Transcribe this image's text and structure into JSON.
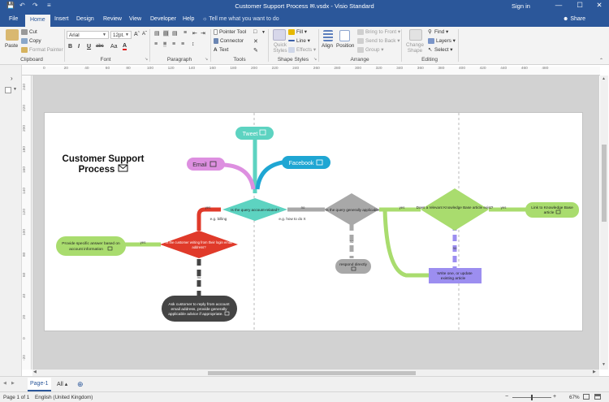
{
  "window": {
    "title": "Customer Support Process ✉.vsdx  -  Visio Standard",
    "sign_in": "Sign in",
    "minimize": "—",
    "restore": "☐",
    "close": "✕",
    "qat": {
      "save": "💾",
      "undo": "↶",
      "redo": "↷",
      "customize": "≡"
    }
  },
  "tabs": [
    "File",
    "Home",
    "Insert",
    "Design",
    "Review",
    "View",
    "Developer",
    "Help"
  ],
  "active_tab": "Home",
  "tell_me": "Tell me what you want to do",
  "share": "Share",
  "ribbon": {
    "clipboard": {
      "label": "Clipboard",
      "paste": "Paste",
      "cut": "Cut",
      "copy": "Copy",
      "format_painter": "Format Painter"
    },
    "font": {
      "label": "Font",
      "font_name": "Arial",
      "font_size": "12pt.",
      "bold": "B",
      "italic": "I",
      "underline": "U",
      "strike": "abc",
      "case": "Aa",
      "color": "A"
    },
    "paragraph": {
      "label": "Paragraph"
    },
    "tools": {
      "label": "Tools",
      "pointer": "Pointer Tool",
      "connector": "Connector",
      "text": "Text"
    },
    "shape_styles": {
      "label": "Shape Styles",
      "quick_styles": "Quick Styles",
      "fill": "Fill",
      "line": "Line",
      "effects": "Effects"
    },
    "arrange": {
      "label": "Arrange",
      "align": "Align",
      "position": "Position",
      "bring_to_front": "Bring to Front",
      "send_to_back": "Send to Back",
      "group": "Group"
    },
    "editing": {
      "label": "Editing",
      "change_shape": "Change Shape",
      "find": "Find",
      "layers": "Layers",
      "select": "Select"
    }
  },
  "ruler": {
    "h": [
      "0",
      "20",
      "40",
      "60",
      "80",
      "100",
      "120",
      "140",
      "160",
      "180",
      "200",
      "220",
      "240",
      "260",
      "280",
      "300",
      "320",
      "340",
      "360",
      "380",
      "400",
      "420",
      "440",
      "460",
      "480"
    ],
    "v": [
      "240",
      "220",
      "200",
      "180",
      "160",
      "140",
      "120",
      "100",
      "80",
      "60",
      "40",
      "20",
      "0",
      "-20"
    ]
  },
  "diagram": {
    "title_line1": "Customer Support",
    "title_line2": "Process",
    "tweet": "Tweet",
    "email": "Email",
    "facebook": "Facebook",
    "q_account": "Is the query account-related?",
    "q_general": "Is the query generally applicable",
    "q_kb": "Does a relevant Knowledge Base article exist?",
    "link_kb_1": "Link to Knowledge Base",
    "link_kb_2": "article",
    "write_kb_1": "Write one, or update",
    "write_kb_2": "existing article",
    "respond_1": "respond directly",
    "q_writing_1": "Is the customer writing from their login email",
    "q_writing_2": "address?",
    "provide_1": "Provide specific answer based on",
    "provide_2": "account information",
    "ask_1": "Ask customer to reply from account",
    "ask_2": "email address, provide generally",
    "ask_3": "applicable advice if appropriate.",
    "eg_billing": "e.g. billing",
    "eg_howto": "e.g. how to do X",
    "yes": "yes",
    "no": "no",
    "colors": {
      "teal": "#5dd3c1",
      "pink": "#dd8fe0",
      "blue": "#1fa6d3",
      "red": "#e03a2a",
      "green": "#a9dc6e",
      "grey": "#a8a8a8",
      "purple": "#9c8ef0",
      "dark": "#444444"
    }
  },
  "page_tabs": {
    "page": "Page-1",
    "all": "All ▴",
    "add": "⊕"
  },
  "status": {
    "page": "Page 1 of 1",
    "language": "English (United Kingdom)",
    "zoom": "67%"
  }
}
